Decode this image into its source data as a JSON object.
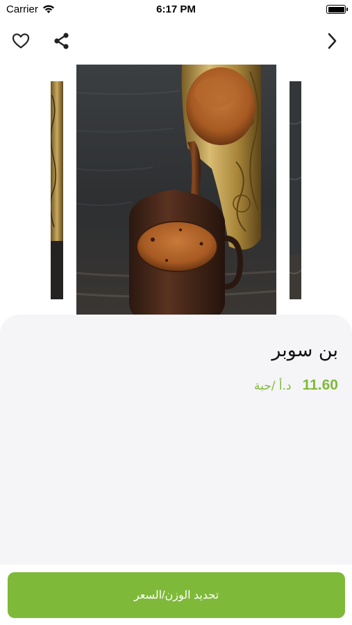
{
  "status_bar": {
    "carrier": "Carrier",
    "time": "6:17 PM"
  },
  "nav": {
    "favorite_icon": "heart-icon",
    "share_icon": "share-icon",
    "back_icon": "chevron-right-icon"
  },
  "product": {
    "name": "بن سوبر",
    "price": "11.60",
    "unit": "د.أ /حبة"
  },
  "actions": {
    "set_weight_price_label": "تحديد الوزن/السعر"
  },
  "colors": {
    "accent": "#7fb93a",
    "sheet_background": "#f5f5f7"
  }
}
